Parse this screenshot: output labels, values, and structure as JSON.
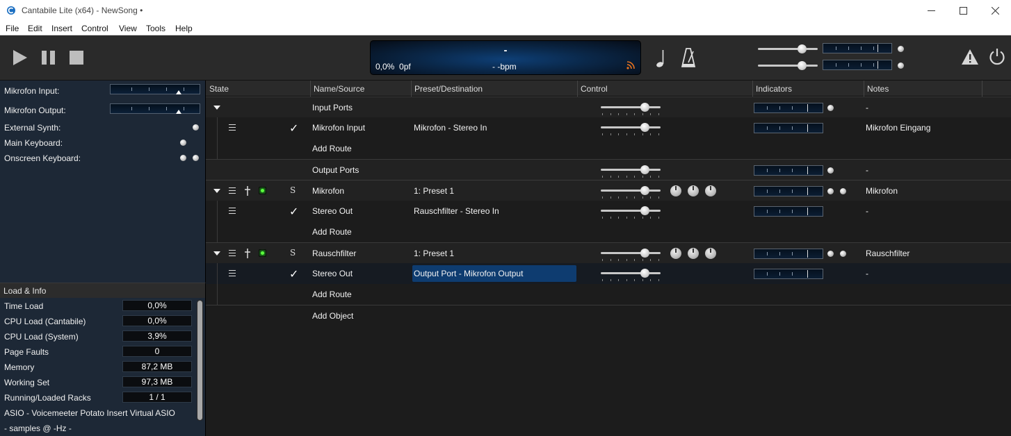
{
  "window": {
    "title": "Cantabile Lite (x64) - NewSong •"
  },
  "menu": [
    "File",
    "Edit",
    "Insert",
    "Control",
    "View",
    "Tools",
    "Help"
  ],
  "transport": {
    "play": "play-icon",
    "pause": "pause-icon",
    "stop": "stop-icon"
  },
  "lcd": {
    "song": "-",
    "load": "0,0%",
    "faults": "0pf",
    "tempo": "- -bpm"
  },
  "left_panel": {
    "rows": [
      {
        "label": "Mikrofon Input:",
        "type": "meter"
      },
      {
        "label": "Mikrofon Output:",
        "type": "meter"
      },
      {
        "label": "External Synth:",
        "type": "led"
      },
      {
        "label": "Main Keyboard:",
        "type": "led"
      },
      {
        "label": "Onscreen Keyboard:",
        "type": "led2"
      }
    ]
  },
  "load_info": {
    "title": "Load & Info",
    "items": [
      {
        "label": "Time Load",
        "value": "0,0%"
      },
      {
        "label": "CPU Load (Cantabile)",
        "value": "0,0%"
      },
      {
        "label": "CPU Load (System)",
        "value": "3,9%"
      },
      {
        "label": "Page Faults",
        "value": "0"
      },
      {
        "label": "Memory",
        "value": "87,2 MB"
      },
      {
        "label": "Working Set",
        "value": "97,3 MB"
      },
      {
        "label": "Running/Loaded Racks",
        "value": "1 / 1"
      }
    ],
    "driver": "ASIO - Voicemeeter Potato Insert Virtual ASIO",
    "samples": "- samples @ -Hz -"
  },
  "columns": [
    "State",
    "Name/Source",
    "Preset/Destination",
    "Control",
    "Indicators",
    "Notes"
  ],
  "rows": [
    {
      "kind": "group",
      "name": "Input Ports",
      "preset": "",
      "notes": "-"
    },
    {
      "kind": "route",
      "name": "Mikrofon Input",
      "preset": "Mikrofon - Stereo In",
      "notes": "Mikrofon Eingang"
    },
    {
      "kind": "add",
      "name": "Add Route"
    },
    {
      "kind": "group",
      "name": "Output Ports",
      "preset": "",
      "notes": "-"
    },
    {
      "kind": "plugin",
      "name": "Mikrofon",
      "preset": "1: Preset 1",
      "notes": "Mikrofon",
      "solo": "S"
    },
    {
      "kind": "route",
      "name": "Stereo Out",
      "preset": "Rauschfilter - Stereo In",
      "notes": "-"
    },
    {
      "kind": "add",
      "name": "Add Route"
    },
    {
      "kind": "plugin",
      "name": "Rauschfilter",
      "preset": "1: Preset 1",
      "notes": "Rauschfilter",
      "solo": "S"
    },
    {
      "kind": "route",
      "name": "Stereo Out",
      "preset": "Output Port - Mikrofon Output",
      "notes": "-",
      "selected": true
    },
    {
      "kind": "add",
      "name": "Add Route"
    },
    {
      "kind": "addobj",
      "name": "Add Object"
    }
  ]
}
